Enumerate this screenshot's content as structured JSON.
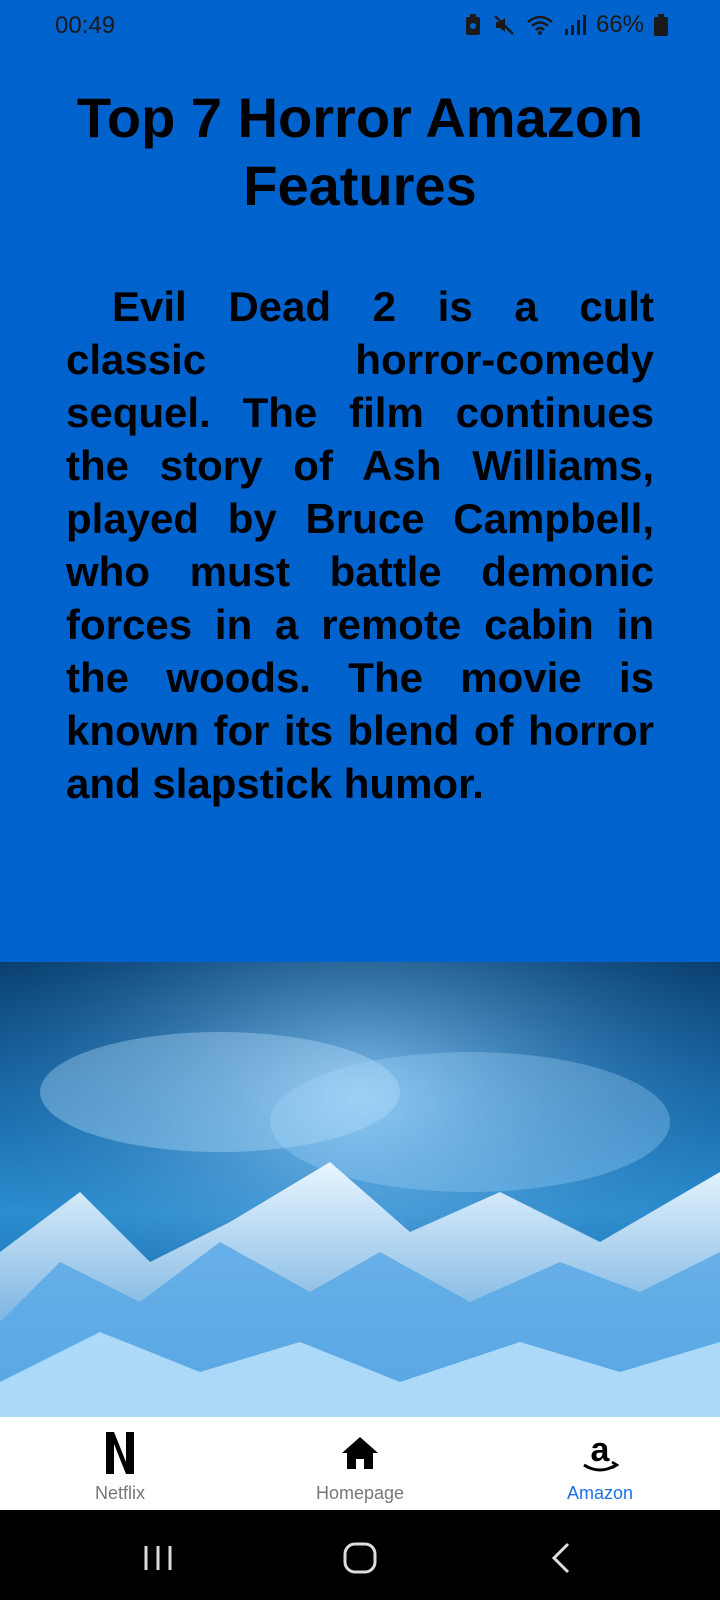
{
  "status_bar": {
    "time": "00:49",
    "battery_percent": "66%",
    "icons": [
      "battery-saver-icon",
      "mute-icon",
      "wifi-icon",
      "signal-icon",
      "battery-icon"
    ]
  },
  "page": {
    "title": "Top 7 Horror Amazon Features",
    "body": "Evil Dead 2 is a cult classic horror-comedy sequel. The film continues the story of Ash Williams, played by Bruce Campbell, who must battle demonic forces in a remote cabin in the woods. The movie is known for its blend of horror and slapstick humor."
  },
  "bottom_nav": {
    "items": [
      {
        "label": "Netflix",
        "icon": "netflix-icon"
      },
      {
        "label": "Homepage",
        "icon": "home-icon"
      },
      {
        "label": "Amazon",
        "icon": "amazon-icon",
        "active": true
      }
    ]
  },
  "colors": {
    "background": "#0062cc",
    "active_tab": "#1a73e8",
    "inactive_tab": "#777777"
  }
}
